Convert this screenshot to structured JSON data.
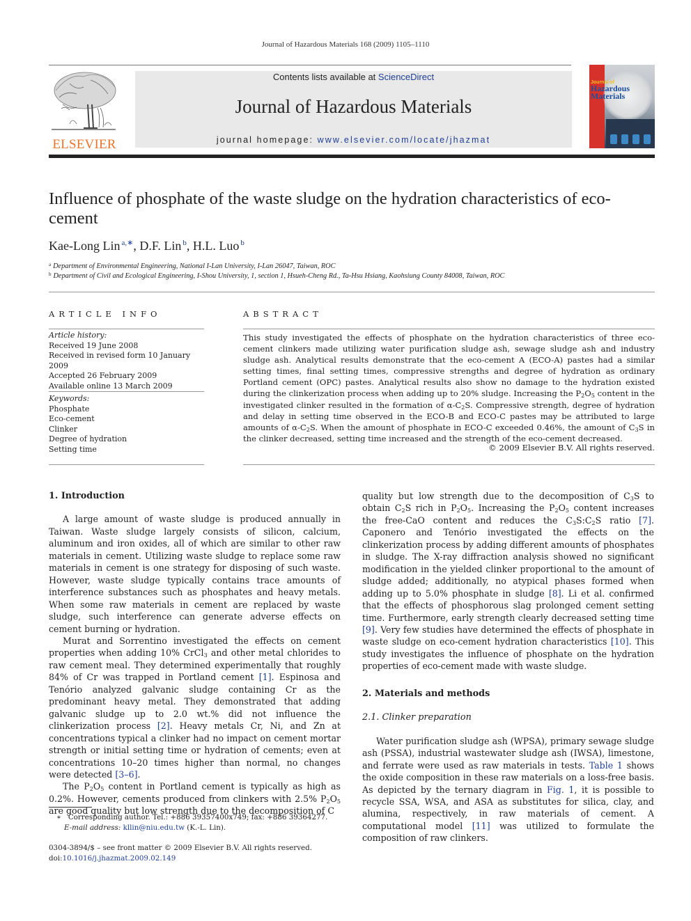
{
  "header": {
    "running_head": "Journal of Hazardous Materials 168 (2009) 1105–1110",
    "contents_prefix": "Contents lists available at ",
    "contents_link": "ScienceDirect",
    "journal_title": "Journal of Hazardous Materials",
    "homepage_prefix": "journal homepage: ",
    "homepage_url": "www.elsevier.com/locate/jhazmat",
    "publisher_logo_text": "ELSEVIER",
    "cover": {
      "title_small": "Journal of",
      "title_line1": "Hazardous",
      "title_line2": "Materials"
    }
  },
  "article": {
    "title": "Influence of phosphate of the waste sludge on the hydration characteristics of eco-cement",
    "authors": [
      {
        "name": "Kae-Long Lin",
        "sup": "a,∗",
        "sep": ", "
      },
      {
        "name": "D.F. Lin",
        "sup": "b",
        "sep": ", "
      },
      {
        "name": "H.L. Luo",
        "sup": "b",
        "sep": ""
      }
    ],
    "affiliations": [
      {
        "mark": "a",
        "text": "Department of Environmental Engineering, National I-Lan University, I-Lan 26047, Taiwan, ROC"
      },
      {
        "mark": "b",
        "text": "Department of Civil and Ecological Engineering, I-Shou University, 1, section 1, Hsueh-Cheng Rd., Ta-Hsu Hsiang, Kaohsiung County 84008, Taiwan, ROC"
      }
    ]
  },
  "article_info": {
    "heading": "ARTICLE INFO",
    "history_label": "Article history:",
    "history": [
      "Received 19 June 2008",
      "Received in revised form 10 January 2009",
      "Accepted 26 February 2009",
      "Available online 13 March 2009"
    ],
    "keywords_label": "Keywords:",
    "keywords": [
      "Phosphate",
      "Eco-cement",
      "Clinker",
      "Degree of hydration",
      "Setting time"
    ]
  },
  "abstract": {
    "heading": "ABSTRACT",
    "parts": {
      "p1": "This study investigated the effects of phosphate on the hydration characteristics of three eco-cement clinkers made utilizing water purification sludge ash, sewage sludge ash and industry sludge ash. Analytical results demonstrate that the eco-cement A (ECO-A) pastes had a similar setting times, final setting times, compressive strengths and degree of hydration as ordinary Portland cement (OPC) pastes. Analytical results also show no damage to the hydration existed during the clinkerization process when adding up to 20% sludge. Increasing the P",
      "p2": "O",
      "p3": " content in the investigated clinker resulted in the formation of α-C",
      "p4": "S. Compressive strength, degree of hydration and delay in setting time observed in the ECO-B and ECO-C pastes may be attributed to large amounts of α-C",
      "p5": "S. When the amount of phosphate in ECO-C exceeded 0.46%, the amount of C",
      "p6": "S in the clinker decreased, setting time increased and the strength of the eco-cement decreased."
    },
    "copyright": "© 2009 Elsevier B.V. All rights reserved."
  },
  "body": {
    "intro_heading": "1.  Introduction",
    "intro_p1": "A large amount of waste sludge is produced annually in Taiwan. Waste sludge largely consists of silicon, calcium, aluminum and iron oxides, all of which are similar to other raw materials in cement. Utilizing waste sludge to replace some raw materials in cement is one strategy for disposing of such waste. However, waste sludge typically contains trace amounts of interference substances such as phosphates and heavy metals. When some raw materials in cement are replaced by waste sludge, such interference can generate adverse effects on cement burning or hydration.",
    "intro_p2": {
      "a": "Murat and Sorrentino investigated the effects on cement properties when adding 10% CrCl",
      "b": " and other metal chlorides to raw cement meal. They determined experimentally that roughly 84% of Cr was trapped in Portland cement ",
      "ref1": "[1]",
      "c": ". Espinosa and Tenório analyzed galvanic sludge containing Cr as the predominant heavy metal. They demonstrated that adding galvanic sludge up to 2.0 wt.% did not influence the clinkerization process ",
      "ref2": "[2]",
      "d": ". Heavy metals Cr, Ni, and Zn at concentrations typical a clinker had no impact on cement mortar strength or initial setting time or hydration of cements; even at concentrations 10–20 times higher than normal, no changes were detected ",
      "ref3": "[3–6]",
      "e": "."
    },
    "intro_p3": {
      "a": "The P",
      "b": "O",
      "c": " content in Portland cement is typically as high as 0.2%. However, cements produced from clinkers with 2.5% P",
      "d": "O",
      "e": " are good quality but low strength due to the decomposition of C",
      "f": "S to obtain C",
      "g": "S rich in P",
      "h": "O",
      "i": ". Increasing the P",
      "j": "O",
      "k": " content increases the free-CaO content and reduces the C",
      "l": "S:C",
      "m": "S ratio ",
      "ref7": "[7]",
      "n": ". Caponero and Tenório investigated the effects on the clinkerization process by adding different amounts of phosphates in sludge. The X-ray diffraction analysis showed no significant modification in the yielded clinker proportional to the amount of sludge added; additionally, no atypical phases formed when adding up to 5.0% phosphate in sludge ",
      "ref8": "[8]",
      "o": ". Li et al. confirmed that the effects of phosphorous slag prolonged cement setting time. Furthermore, early strength clearly decreased setting time ",
      "ref9": "[9]",
      "p": ". Very few studies have determined the effects of phosphate in waste sludge on eco-cement hydration characteristics ",
      "ref10": "[10]",
      "q": ". This study investigates the influence of phosphate on the hydration properties of eco-cement made with waste sludge."
    },
    "methods_heading": "2.  Materials and methods",
    "clinker_heading": "2.1.  Clinker preparation",
    "clinker_p1": {
      "a": "Water purification sludge ash (WPSA), primary sewage sludge ash (PSSA), industrial wastewater sludge ash (IWSA), limestone, and ferrate were used as raw materials in tests. ",
      "table_ref": "Table 1",
      "b": " shows the oxide composition in these raw materials on a loss-free basis. As depicted by the ternary diagram in ",
      "fig_ref": "Fig. 1",
      "c": ", it is possible to recycle SSA, WSA, and ASA as substitutes for silica, clay, and alumina, respectively, in raw materials of cement. A computational model ",
      "ref11": "[11]",
      "d": " was utilized to formulate the composition of raw clinkers."
    }
  },
  "footnotes": {
    "corresponding_mark": "∗",
    "corresponding": "Corresponding author. Tel.: +886 39357400x749; fax: +886 39364277.",
    "email_label": "E-mail address: ",
    "email": "kllin@niu.edu.tw",
    "email_suffix": " (K.-L. Lin).",
    "issn_line": "0304-3894/$ – see front matter © 2009 Elsevier B.V. All rights reserved.",
    "doi_prefix": "doi:",
    "doi": "10.1016/j.jhazmat.2009.02.149"
  },
  "subscripts": {
    "two": "2",
    "three": "3",
    "five": "5"
  }
}
